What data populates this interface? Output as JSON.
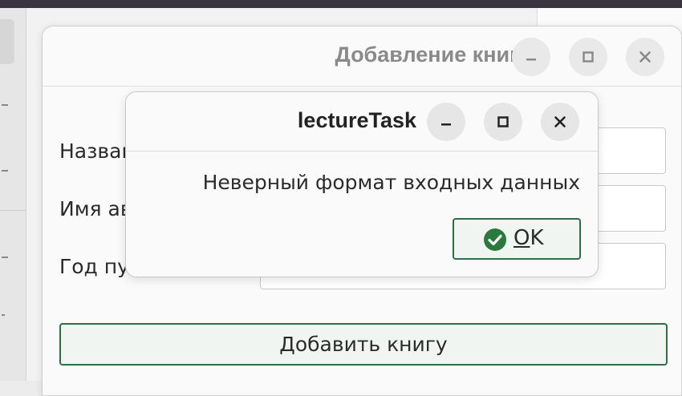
{
  "main_window": {
    "title": "Добавление книги",
    "labels": {
      "title": "Название",
      "author": "Имя автора",
      "year": "Год публикации"
    },
    "add_button": "Добавить книгу"
  },
  "dialog": {
    "title": "lectureTask",
    "message": "Неверный формат входных данных",
    "ok_label": "OK"
  },
  "colors": {
    "accent": "#2f6e45",
    "ok_icon": "#2a7a3e"
  },
  "icons": {
    "minimize": "minimize-icon",
    "maximize": "maximize-icon",
    "close": "close-icon",
    "ok": "checkmark-circle-icon"
  }
}
